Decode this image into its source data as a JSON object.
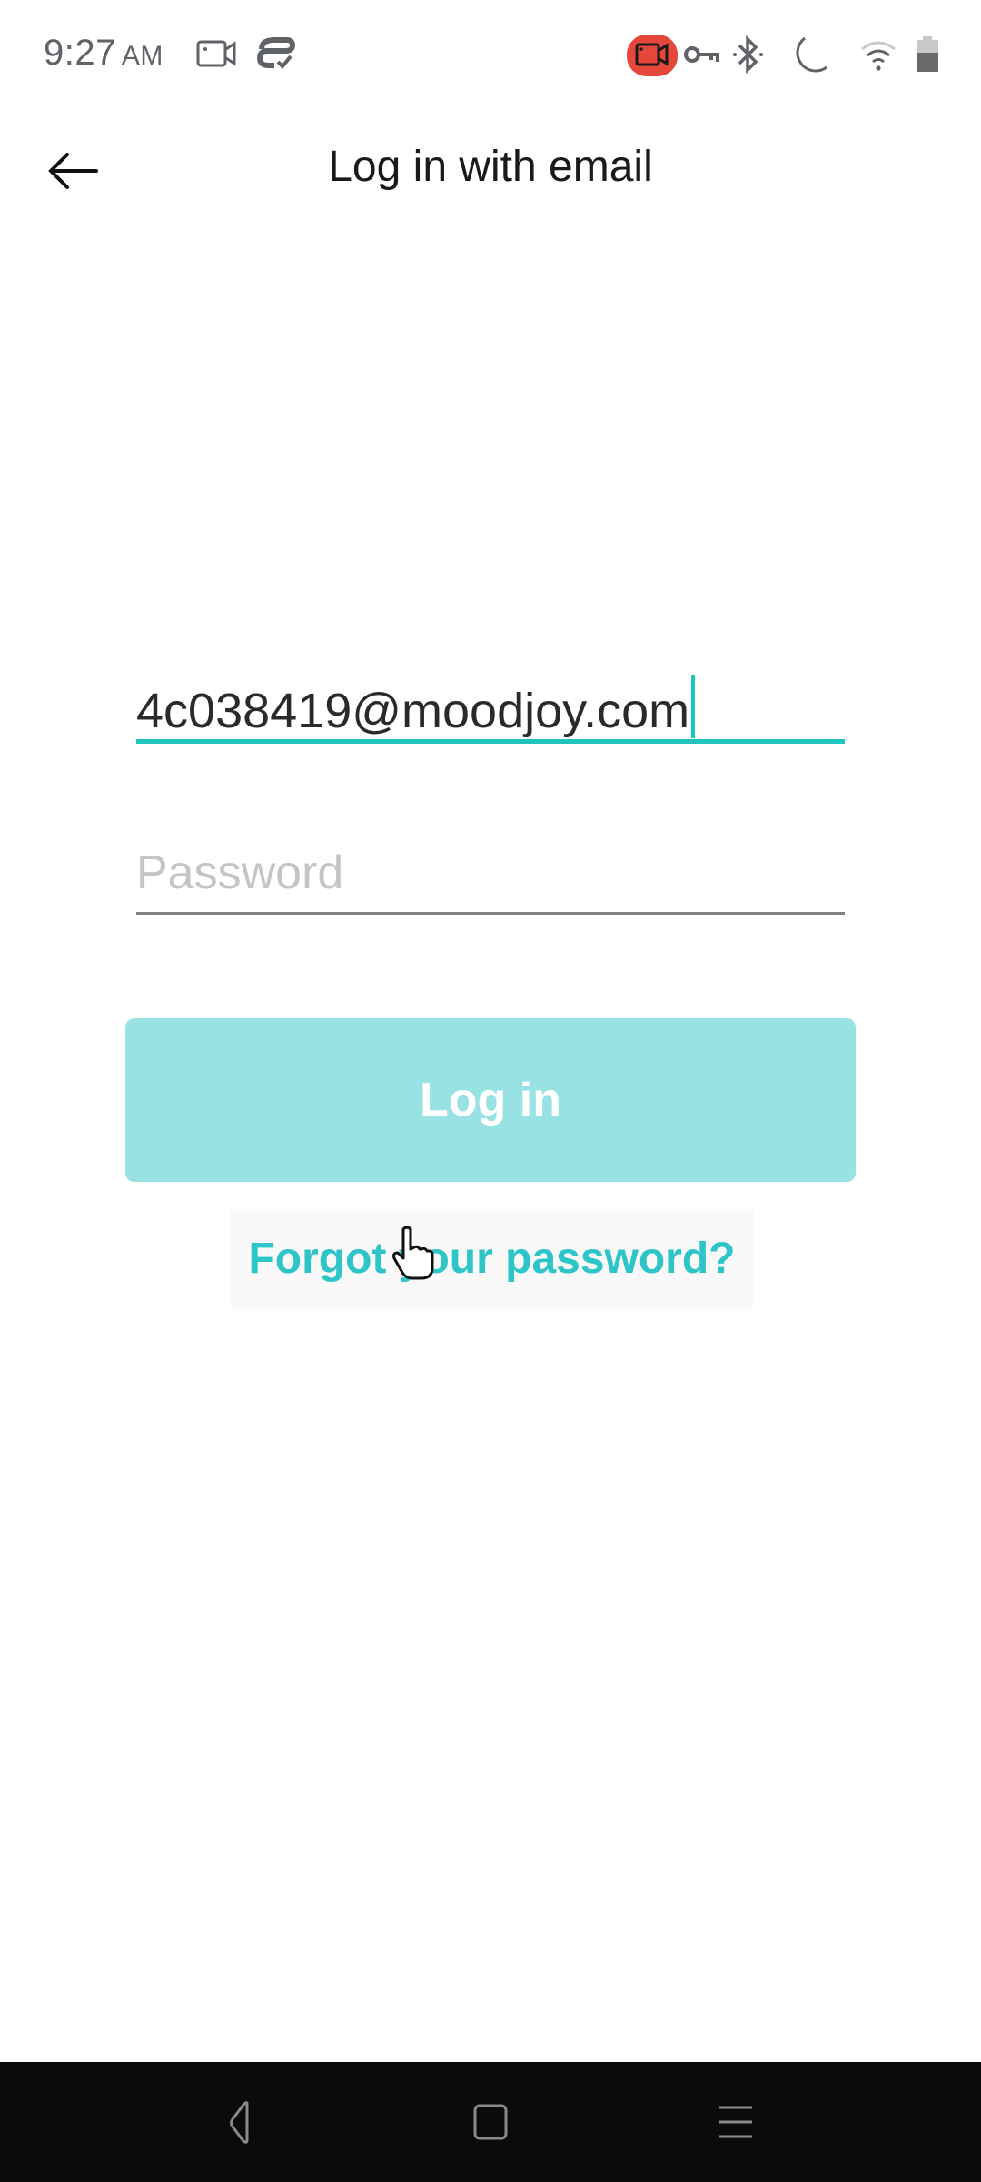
{
  "status_bar": {
    "time": "9:27",
    "ampm": "AM",
    "left_icons": [
      "screen-record-icon",
      "sync-check-icon"
    ],
    "right_icons": [
      "recording-indicator-icon",
      "vpn-key-icon",
      "bluetooth-icon",
      "do-not-disturb-icon",
      "wifi-icon",
      "battery-icon"
    ],
    "recording_color": "#e5483b"
  },
  "app_bar": {
    "back_icon": "arrow-left-icon",
    "title": "Log in with email"
  },
  "form": {
    "email_value": "4c038419@moodjoy.com",
    "password_placeholder": "Password",
    "password_value": "",
    "login_label": "Log in",
    "forgot_label": "Forgot your password?"
  },
  "colors": {
    "accent": "#20c4bc",
    "login_button_bg": "#98e2e4",
    "link": "#2ec5c8"
  },
  "nav_bar": {
    "buttons": [
      "back-nav-icon",
      "home-nav-icon",
      "recents-nav-icon"
    ]
  }
}
